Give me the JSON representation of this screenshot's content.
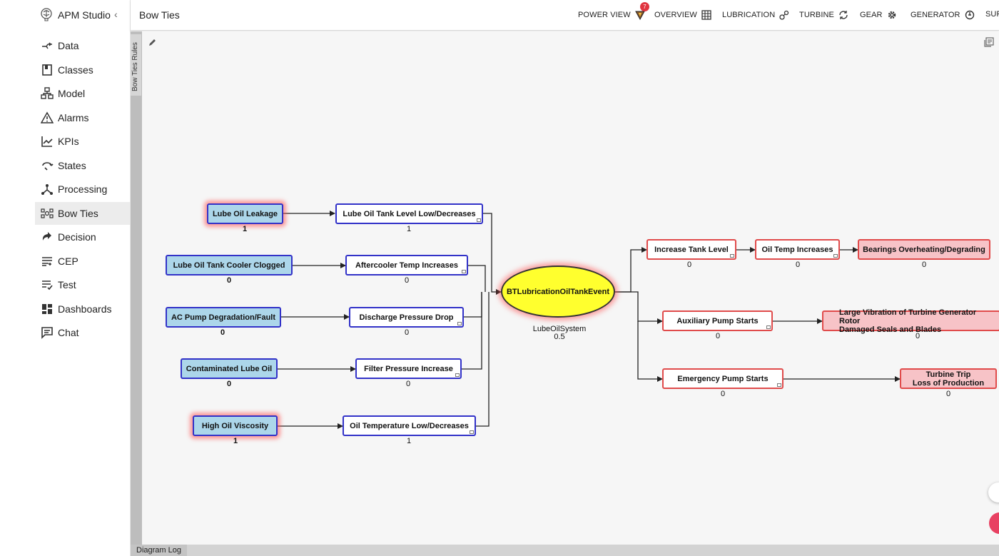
{
  "app": {
    "name": "APM Studio",
    "collapse_icon": "chevron-left-icon"
  },
  "sidebar": {
    "items": [
      {
        "label": "Data",
        "icon": "data-flow-icon"
      },
      {
        "label": "Classes",
        "icon": "book-icon"
      },
      {
        "label": "Model",
        "icon": "hierarchy-icon"
      },
      {
        "label": "Alarms",
        "icon": "warning-icon"
      },
      {
        "label": "KPIs",
        "icon": "trend-chart-icon"
      },
      {
        "label": "States",
        "icon": "cycle-icon"
      },
      {
        "label": "Processing",
        "icon": "branch-icon"
      },
      {
        "label": "Bow Ties",
        "icon": "bowtie-icon",
        "active": true
      },
      {
        "label": "Decision",
        "icon": "decision-icon"
      },
      {
        "label": "CEP",
        "icon": "cep-icon"
      },
      {
        "label": "Test",
        "icon": "checklist-icon"
      },
      {
        "label": "Dashboards",
        "icon": "dashboard-grid-icon"
      },
      {
        "label": "Chat",
        "icon": "chat-icon"
      }
    ]
  },
  "header": {
    "title": "Bow Ties",
    "nav": [
      {
        "label": "POWER VIEW",
        "icon": "power-view-icon",
        "badge": "7"
      },
      {
        "label": "OVERVIEW",
        "icon": "grid-icon"
      },
      {
        "label": "LUBRICATION",
        "icon": "droplets-icon"
      },
      {
        "label": "TURBINE",
        "icon": "rotate-icon"
      },
      {
        "label": "GEAR",
        "icon": "gear-icon"
      },
      {
        "label": "GENERATOR",
        "icon": "power-icon"
      },
      {
        "label": "SUP"
      }
    ]
  },
  "side_tab": {
    "label": "Bow Ties Rules"
  },
  "bottom": {
    "tab_label": "Diagram Log"
  },
  "diagram": {
    "event": {
      "label": "BTLubricationOilTankEvent",
      "system": "LubeOilSystem",
      "value": "0.5"
    },
    "causes": [
      {
        "label": "Lube Oil Leakage",
        "value": "1",
        "alarmed": true
      },
      {
        "label": "Lube Oil Tank Cooler Clogged",
        "value": "0",
        "alarmed": false
      },
      {
        "label": "AC Pump Degradation/Fault",
        "value": "0",
        "alarmed": false
      },
      {
        "label": "Contaminated Lube Oil",
        "value": "0",
        "alarmed": false
      },
      {
        "label": "High Oil Viscosity",
        "value": "1",
        "alarmed": true
      }
    ],
    "barriers": [
      {
        "label": "Lube Oil Tank Level Low/Decreases",
        "value": "1"
      },
      {
        "label": "Aftercooler Temp Increases",
        "value": "0"
      },
      {
        "label": "Discharge Pressure Drop",
        "value": "0"
      },
      {
        "label": "Filter Pressure Increase",
        "value": "0"
      },
      {
        "label": "Oil Temperature Low/Decreases",
        "value": "1"
      }
    ],
    "consequences": [
      {
        "label": "Increase Tank Level",
        "value": "0"
      },
      {
        "label": "Oil Temp Increases",
        "value": "0"
      },
      {
        "label": "Bearings Overheating/Degrading",
        "value": "0"
      },
      {
        "label": "Auxiliary Pump Starts",
        "value": "0"
      },
      {
        "label": "Large Vibration of Turbine Generator Rotor\nDamaged Seals and Blades",
        "value": "0"
      },
      {
        "label": "Emergency Pump Starts",
        "value": "0"
      },
      {
        "label": "Turbine Trip\nLoss of Production",
        "value": "0"
      }
    ]
  }
}
